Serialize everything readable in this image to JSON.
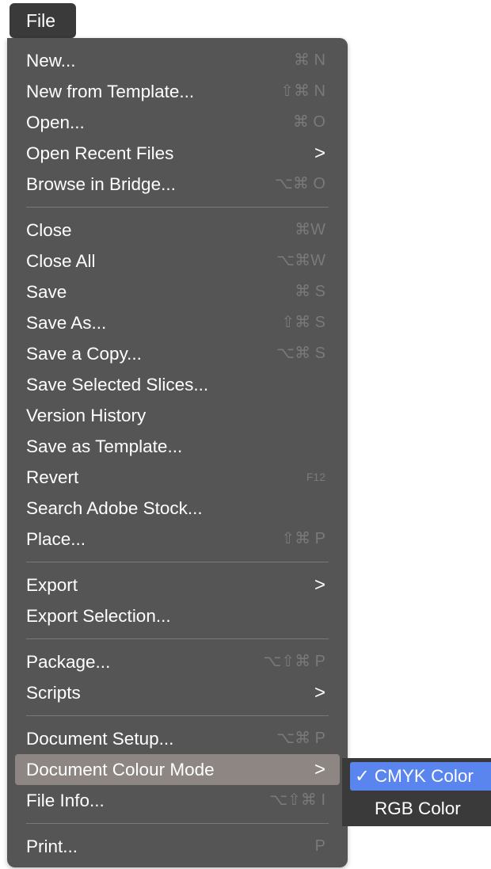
{
  "menubar": {
    "file_label": "File"
  },
  "menu": {
    "groups": [
      [
        {
          "label": "New...",
          "shortcut": "⌘ N"
        },
        {
          "label": "New from Template...",
          "shortcut": "⇧⌘ N"
        },
        {
          "label": "Open...",
          "shortcut": "⌘ O"
        },
        {
          "label": "Open Recent Files",
          "submenu": true
        },
        {
          "label": "Browse in Bridge...",
          "shortcut": "⌥⌘ O"
        }
      ],
      [
        {
          "label": "Close",
          "shortcut": "⌘W"
        },
        {
          "label": "Close All",
          "shortcut": "⌥⌘W"
        },
        {
          "label": "Save",
          "shortcut": "⌘ S"
        },
        {
          "label": "Save As...",
          "shortcut": "⇧⌘ S"
        },
        {
          "label": "Save a Copy...",
          "shortcut": "⌥⌘ S"
        },
        {
          "label": "Save Selected Slices..."
        },
        {
          "label": "Version History"
        },
        {
          "label": "Save as Template..."
        },
        {
          "label": "Revert",
          "shortcut": "F12"
        },
        {
          "label": "Search Adobe Stock..."
        },
        {
          "label": "Place...",
          "shortcut": "⇧⌘ P"
        }
      ],
      [
        {
          "label": "Export",
          "submenu": true
        },
        {
          "label": "Export Selection..."
        }
      ],
      [
        {
          "label": "Package...",
          "shortcut": "⌥⇧⌘ P"
        },
        {
          "label": "Scripts",
          "submenu": true
        }
      ],
      [
        {
          "label": "Document Setup...",
          "shortcut": "⌥⌘ P"
        },
        {
          "label": "Document Colour Mode",
          "submenu": true,
          "highlighted": true
        },
        {
          "label": "File Info...",
          "shortcut": "⌥⇧⌘ I"
        }
      ],
      [
        {
          "label": "Print...",
          "shortcut": "P"
        }
      ]
    ],
    "submenu_arrow": ">"
  },
  "colour_mode_submenu": {
    "items": [
      {
        "label": "CMYK Color",
        "checked": true,
        "check_mark": "✓"
      },
      {
        "label": "RGB Color",
        "checked": false
      }
    ]
  },
  "colors": {
    "menu_bg": "#555555",
    "highlight": "#8e8683",
    "submenu_bg": "#3a3a3a",
    "selected_blue": "#5a84ee",
    "shortcut_gray": "#7a7a7a"
  }
}
